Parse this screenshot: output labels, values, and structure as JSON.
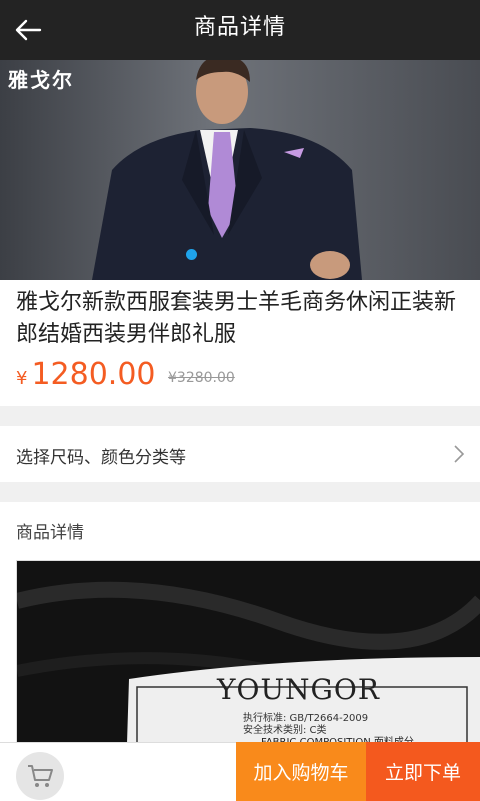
{
  "header": {
    "title": "商品详情",
    "back_icon": "arrow-left-icon"
  },
  "banner": {
    "brand": "雅戈尔",
    "indicator_active": 1,
    "indicator_count": 1
  },
  "product": {
    "name": "雅戈尔新款西服套装男士羊毛商务休闲正装新郎结婚西装男伴郎礼服",
    "currency": "¥",
    "price": "1280.00",
    "original_price": "¥3280.00"
  },
  "options": {
    "label": "选择尺码、颜色分类等",
    "chevron_icon": "chevron-right-icon"
  },
  "details": {
    "title": "商品详情",
    "label_brand": "YOUNGOR",
    "label_lines": [
      "执行标准: GB/T2664-2009",
      "安全技术类别: C类",
      "FABRIC COMPOSITION 面料成分"
    ]
  },
  "bottom": {
    "cart_icon": "shopping-cart-icon",
    "add_to_cart": "加入购物车",
    "buy_now": "立即下单"
  },
  "colors": {
    "accent": "#f45c22",
    "add_cart_bg": "#f98a1b",
    "buy_bg": "#f4591e",
    "topbar": "#232323",
    "dot": "#1fa3ea"
  }
}
